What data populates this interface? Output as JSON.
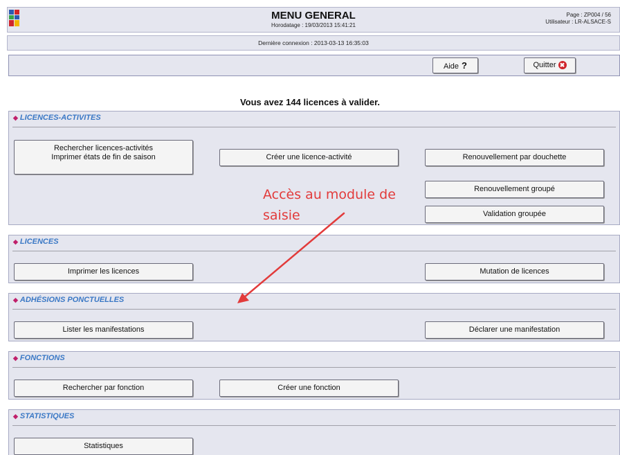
{
  "header": {
    "title": "MENU GENERAL",
    "timestamp": "Horodatage : 19/03/2013 15:41:21",
    "page_label": "Page : ZP004 / 56",
    "user_label": "Utilisateur : LR-ALSACE-S"
  },
  "last_connection": "Dernière connexion : 2013-03-13 16:35:03",
  "toolbar": {
    "help_label": "Aide",
    "help_icon": "?",
    "quit_label": "Quitter",
    "quit_icon": "✖"
  },
  "notice": "Vous avez 144 licences à valider.",
  "sections": {
    "licences_activites": {
      "title": "LICENCES-ACTIVITES",
      "search_line1": "Rechercher licences-activités",
      "search_line2": "Imprimer états de fin de saison",
      "create": "Créer une licence-activité",
      "renew_scan": "Renouvellement par douchette",
      "renew_group": "Renouvellement groupé",
      "validate_group": "Validation groupée"
    },
    "licences": {
      "title": "LICENCES",
      "print": "Imprimer les licences",
      "transfer": "Mutation de licences"
    },
    "adhesions": {
      "title": "ADHÉSIONS PONCTUELLES",
      "list": "Lister les manifestations",
      "declare": "Déclarer une manifestation"
    },
    "fonctions": {
      "title": "FONCTIONS",
      "search": "Rechercher par fonction",
      "create": "Créer une fonction"
    },
    "statistiques": {
      "title": "STATISTIQUES",
      "stats": "Statistiques"
    }
  },
  "annotation": {
    "line1": "Accès au module de",
    "line2": "saisie",
    "color": "#e23b3b"
  },
  "colors": {
    "panel": "#e5e6ef",
    "section_title": "#3a78c5",
    "bullet": "#c0206b"
  }
}
